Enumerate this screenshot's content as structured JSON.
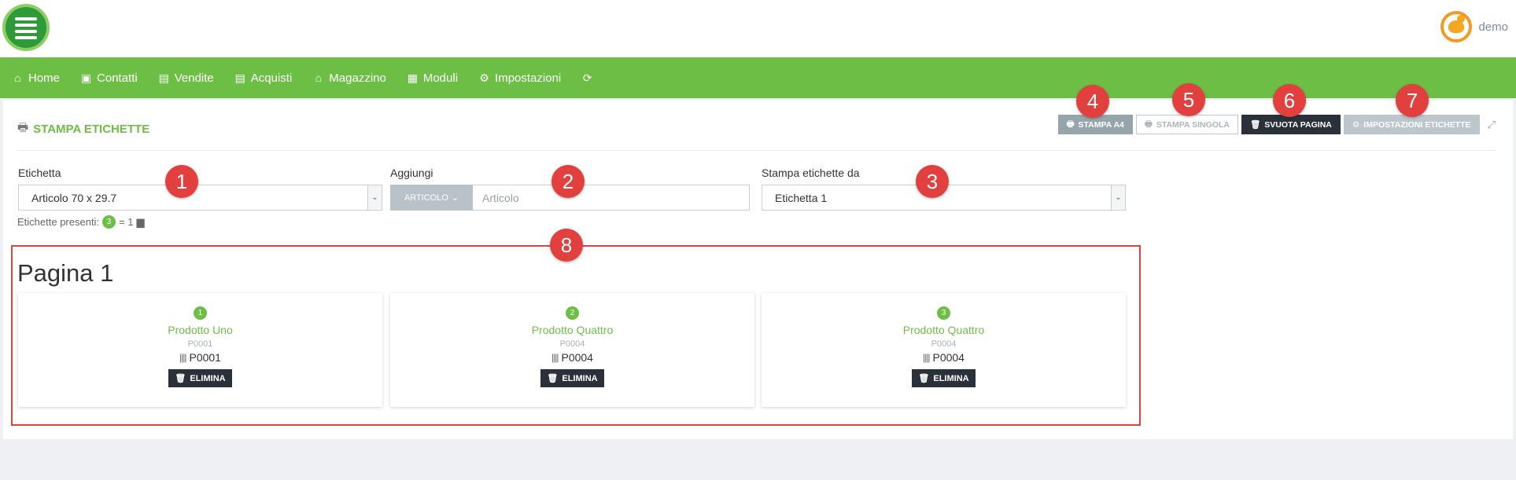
{
  "header": {
    "username": "demo"
  },
  "nav": [
    {
      "label": "Home",
      "icon": "home-icon",
      "glyph": "⌂"
    },
    {
      "label": "Contatti",
      "icon": "contacts-icon",
      "glyph": "▣"
    },
    {
      "label": "Vendite",
      "icon": "sales-icon",
      "glyph": "▤"
    },
    {
      "label": "Acquisti",
      "icon": "purchases-icon",
      "glyph": "▤"
    },
    {
      "label": "Magazzino",
      "icon": "warehouse-icon",
      "glyph": "⌂"
    },
    {
      "label": "Moduli",
      "icon": "modules-icon",
      "glyph": "▦"
    },
    {
      "label": "Impostazioni",
      "icon": "settings-icon",
      "glyph": "⚙"
    },
    {
      "label": "",
      "icon": "refresh-icon",
      "glyph": "⟳"
    }
  ],
  "panel": {
    "title": "STAMPA ETICHETTE",
    "toolbar": {
      "print_a4": "STAMPA A4",
      "print_single": "STAMPA SINGOLA",
      "clear_page": "SVUOTA PAGINA",
      "label_settings": "IMPOSTAZIONI ETICHETTE"
    },
    "fields": {
      "etichetta_label": "Etichetta",
      "etichetta_value": "Articolo 70 x 29.7",
      "aggiungi_label": "Aggiungi",
      "aggiungi_button": "ARTICOLO",
      "aggiungi_placeholder": "Articolo",
      "stampa_da_label": "Stampa etichette da",
      "stampa_da_value": "Etichetta 1"
    },
    "presenti": {
      "label": "Etichette presenti:",
      "count": "3",
      "pages": "= 1"
    },
    "page_title": "Pagina 1",
    "cards": [
      {
        "num": "1",
        "name": "Prodotto Uno",
        "code": "P0001",
        "barcode": "P0001",
        "delete": "ELIMINA"
      },
      {
        "num": "2",
        "name": "Prodotto Quattro",
        "code": "P0004",
        "barcode": "P0004",
        "delete": "ELIMINA"
      },
      {
        "num": "3",
        "name": "Prodotto Quattro",
        "code": "P0004",
        "barcode": "P0004",
        "delete": "ELIMINA"
      }
    ]
  },
  "annotations": [
    "1",
    "2",
    "3",
    "4",
    "5",
    "6",
    "7",
    "8"
  ],
  "colors": {
    "brand_green": "#6dbe45",
    "dark_button": "#2b313b",
    "annotation_red": "#e2403e"
  }
}
